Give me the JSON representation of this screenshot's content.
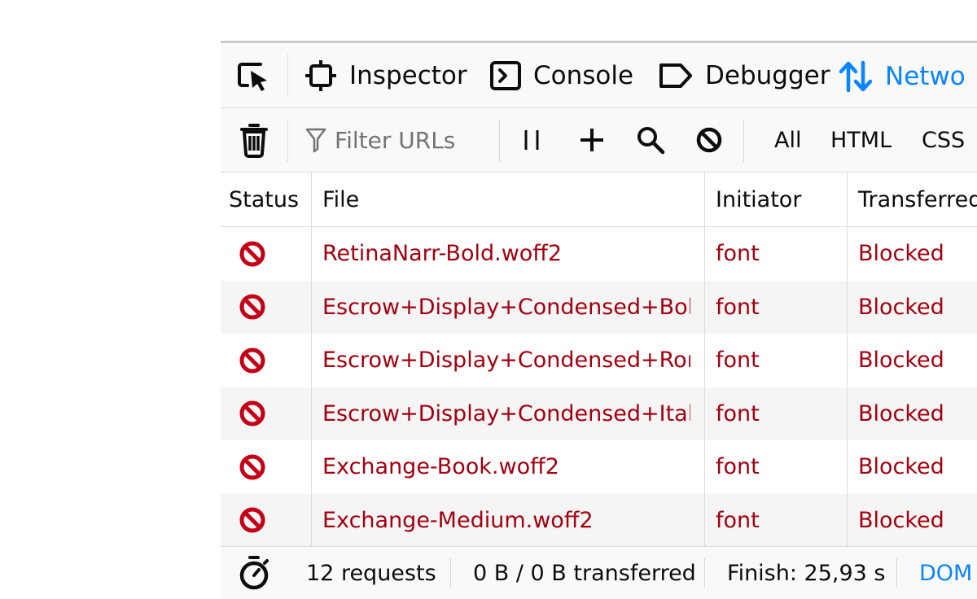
{
  "toolbox": {
    "tabs": [
      {
        "label": "Inspector",
        "icon": "inspector-icon"
      },
      {
        "label": "Console",
        "icon": "console-icon"
      },
      {
        "label": "Debugger",
        "icon": "debugger-icon"
      },
      {
        "label": "Netwo",
        "icon": "network-icon",
        "selected": true
      }
    ],
    "accent_color": "#0a84ff"
  },
  "network_toolbar": {
    "filter_placeholder": "Filter URLs",
    "type_filters": [
      "All",
      "HTML",
      "CSS"
    ]
  },
  "table": {
    "columns": [
      "Status",
      "File",
      "Initiator",
      "Transferred"
    ],
    "rows": [
      {
        "status_icon": "blocked-icon",
        "file": "RetinaNarr-Bold.woff2",
        "initiator": "font",
        "transferred": "Blocked"
      },
      {
        "status_icon": "blocked-icon",
        "file": "Escrow+Display+Condensed+Bold.w",
        "initiator": "font",
        "transferred": "Blocked"
      },
      {
        "status_icon": "blocked-icon",
        "file": "Escrow+Display+Condensed+Roma",
        "initiator": "font",
        "transferred": "Blocked"
      },
      {
        "status_icon": "blocked-icon",
        "file": "Escrow+Display+Condensed+Italic.",
        "initiator": "font",
        "transferred": "Blocked"
      },
      {
        "status_icon": "blocked-icon",
        "file": "Exchange-Book.woff2",
        "initiator": "font",
        "transferred": "Blocked"
      },
      {
        "status_icon": "blocked-icon",
        "file": "Exchange-Medium.woff2",
        "initiator": "font",
        "transferred": "Blocked"
      }
    ],
    "blocked_color": "#a4000f"
  },
  "status_bar": {
    "requests": "12 requests",
    "transferred": "0 B / 0 B transferred",
    "finish": "Finish: 25,93 s",
    "dom": "DOM"
  }
}
